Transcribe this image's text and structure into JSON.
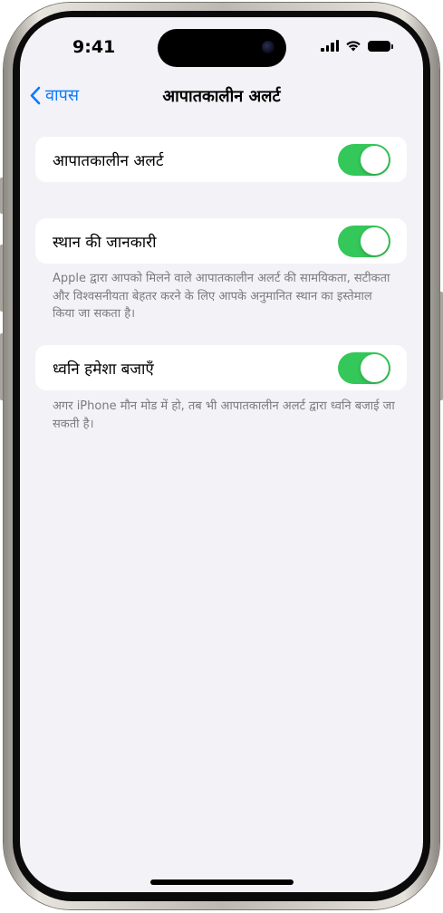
{
  "status_bar": {
    "time": "9:41"
  },
  "nav": {
    "back_label": "वापस",
    "title": "आपातकालीन अलर्ट"
  },
  "settings": [
    {
      "label": "आपातकालीन अलर्ट",
      "enabled": true,
      "footnote": ""
    },
    {
      "label": "स्थान की जानकारी",
      "enabled": true,
      "footnote": "Apple द्वारा आपको मिलने वाले आपातकालीन अलर्ट की सामयिकता, सटीकता और विश्वसनीयता बेहतर करने के लिए आपके अनुमानित स्थान का इस्तेमाल किया जा सकता है।"
    },
    {
      "label": "ध्वनि हमेशा बजाएँ",
      "enabled": true,
      "footnote": "अगर iPhone मौन मोड में हो, तब भी आपातकालीन अलर्ट द्वारा ध्वनि बजाई जा सकती है।"
    }
  ],
  "colors": {
    "accent": "#0a7aff",
    "toggle_on": "#34c759",
    "background": "#f2f2f7"
  }
}
